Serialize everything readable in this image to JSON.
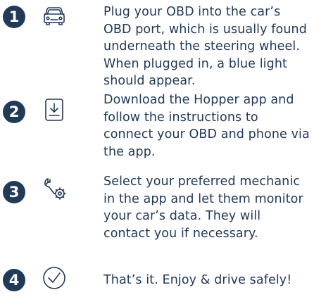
{
  "steps": [
    {
      "number": "1",
      "icon": "car-icon",
      "text": "Plug your OBD into the car’s OBD port, which is usually found underneath the steering wheel. When plugged in, a blue light should appear."
    },
    {
      "number": "2",
      "icon": "download-icon",
      "text": "Download the Hopper app and follow the instructions to connect your OBD and phone via the app."
    },
    {
      "number": "3",
      "icon": "mechanic-icon",
      "text": "Select your preferred mechanic in the app and let them monitor your car’s data. They will contact you if necessary."
    },
    {
      "number": "4",
      "icon": "check-circle-icon",
      "text": "That’s it. Enjoy & drive safely!"
    }
  ],
  "colors": {
    "primary": "#213a58",
    "background": "#ffffff"
  }
}
